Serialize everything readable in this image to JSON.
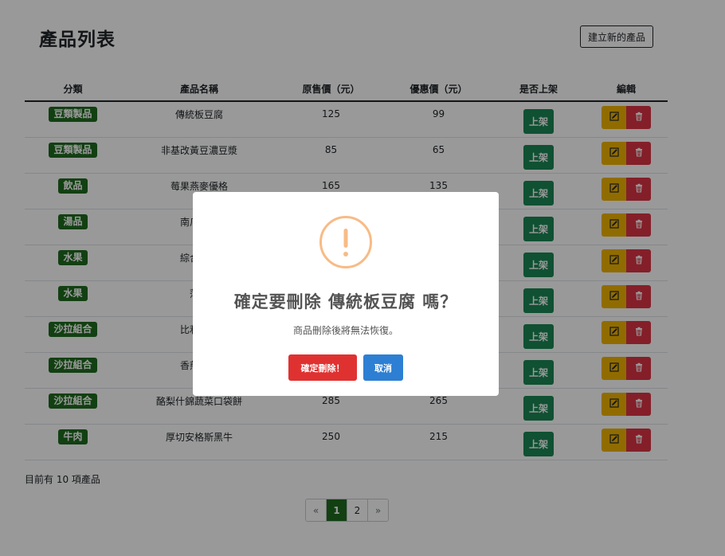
{
  "header": {
    "title": "產品列表",
    "create_label": "建立新的產品"
  },
  "table": {
    "columns": [
      "分類",
      "產品名稱",
      "原售價（元）",
      "優惠價（元）",
      "是否上架",
      "編輯"
    ],
    "rows": [
      {
        "category": "豆類製品",
        "name": "傳統板豆腐",
        "origin_price": "125",
        "price": "99",
        "status": "上架"
      },
      {
        "category": "豆類製品",
        "name": "非基改黃豆濃豆漿",
        "origin_price": "85",
        "price": "65",
        "status": "上架"
      },
      {
        "category": "飲品",
        "name": "莓果燕麥優格",
        "origin_price": "165",
        "price": "135",
        "status": "上架"
      },
      {
        "category": "湯品",
        "name": "南瓜馬鈴",
        "origin_price": "",
        "price": "",
        "status": "上架"
      },
      {
        "category": "水果",
        "name": "綜合起司",
        "origin_price": "",
        "price": "",
        "status": "上架"
      },
      {
        "category": "水果",
        "name": "薄切",
        "origin_price": "",
        "price": "",
        "status": "上架"
      },
      {
        "category": "沙拉組合",
        "name": "比利時溫",
        "origin_price": "",
        "price": "",
        "status": "上架"
      },
      {
        "category": "沙拉組合",
        "name": "香煎鮭魚",
        "origin_price": "",
        "price": "",
        "status": "上架"
      },
      {
        "category": "沙拉組合",
        "name": "酪梨什錦蔬菜口袋餅",
        "origin_price": "285",
        "price": "265",
        "status": "上架"
      },
      {
        "category": "牛肉",
        "name": "厚切安格斯黑牛",
        "origin_price": "250",
        "price": "215",
        "status": "上架"
      }
    ]
  },
  "footer": {
    "count_text": "目前有 10 項產品"
  },
  "pagination": {
    "prev": "«",
    "pages": [
      "1",
      "2"
    ],
    "active": "1",
    "next": "»"
  },
  "modal": {
    "icon": "exclamation-circle-icon",
    "title": "確定要刪除 傳統板豆腐 嗎？",
    "text": "商品刪除後將無法恢復。",
    "confirm_label": "確定刪除！",
    "cancel_label": "取消"
  },
  "colors": {
    "badge": "#1e6b1e",
    "shelf_button": "#198754",
    "edit_button": "#f0b400",
    "delete_button": "#dc3545",
    "confirm_button": "#e03131",
    "cancel_button": "#2d7fd3",
    "warning_icon": "#f8bb86"
  }
}
